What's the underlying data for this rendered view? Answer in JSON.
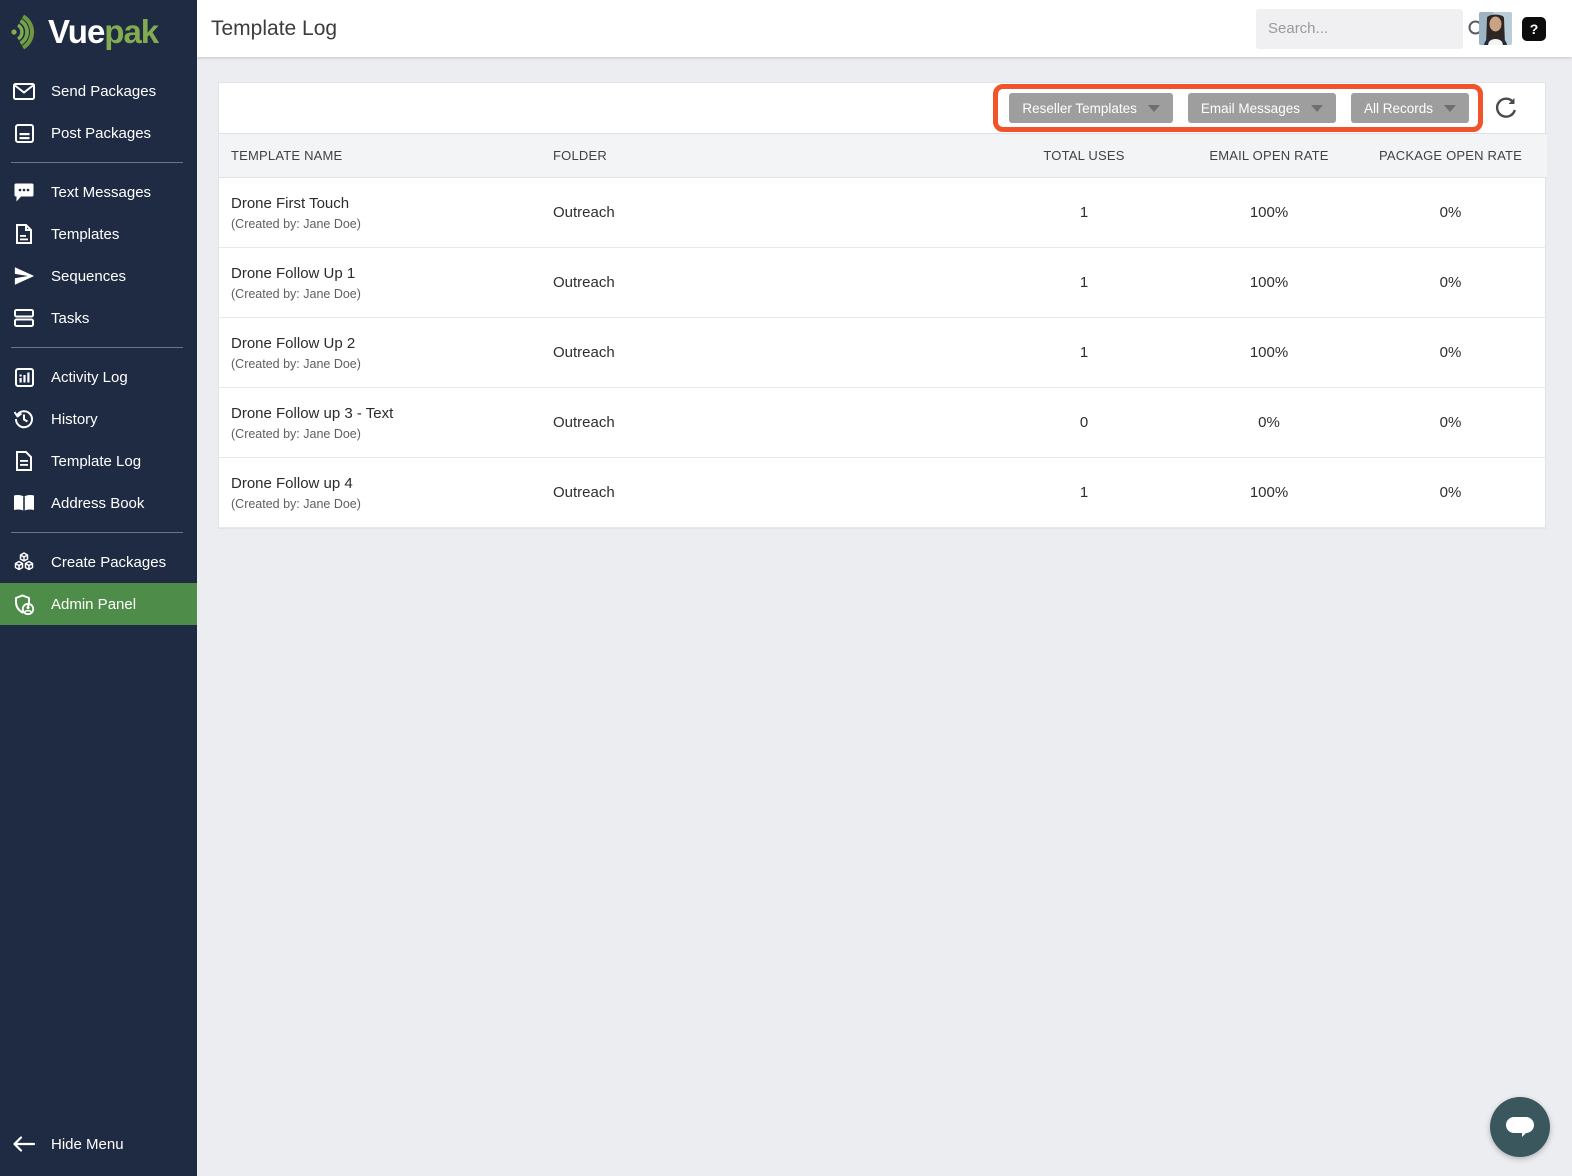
{
  "brand": {
    "logo_icon": "sound-wave-arcs-icon",
    "name_primary": "Vue",
    "name_secondary": "pak"
  },
  "header": {
    "title": "Template Log",
    "search_placeholder": "Search...",
    "help_label": "?",
    "icons": [
      "search-icon",
      "user-avatar",
      "help-icon"
    ]
  },
  "sidebar": {
    "sections": [
      {
        "items": [
          {
            "icon": "envelope-icon",
            "label": "Send Packages"
          },
          {
            "icon": "post-document-icon",
            "label": "Post Packages"
          }
        ]
      },
      {
        "items": [
          {
            "icon": "chat-bubble-dots-icon",
            "label": "Text Messages"
          },
          {
            "icon": "file-icon",
            "label": "Templates"
          },
          {
            "icon": "send-plane-icon",
            "label": "Sequences"
          },
          {
            "icon": "stacked-rows-icon",
            "label": "Tasks"
          }
        ]
      },
      {
        "items": [
          {
            "icon": "bar-chart-icon",
            "label": "Activity Log"
          },
          {
            "icon": "history-clock-icon",
            "label": "History"
          },
          {
            "icon": "file-lines-icon",
            "label": "Template Log"
          },
          {
            "icon": "address-book-icon",
            "label": "Address Book"
          }
        ]
      },
      {
        "items": [
          {
            "icon": "cubes-icon",
            "label": "Create Packages"
          },
          {
            "icon": "admin-shield-icon",
            "label": "Admin Panel",
            "active": true
          }
        ]
      }
    ],
    "footer": {
      "icon": "back-arrow-icon",
      "label": "Hide Menu"
    }
  },
  "toolbar": {
    "dropdowns": [
      {
        "label": "Reseller Templates",
        "icon": "caret-down-icon"
      },
      {
        "label": "Email Messages",
        "icon": "caret-down-icon"
      },
      {
        "label": "All Records",
        "icon": "caret-down-icon"
      }
    ],
    "refresh_icon": "refresh-icon",
    "annotation": "orange-highlight-box"
  },
  "table": {
    "columns": [
      "TEMPLATE NAME",
      "FOLDER",
      "TOTAL USES",
      "EMAIL OPEN RATE",
      "PACKAGE OPEN RATE"
    ],
    "rows": [
      {
        "name": "Drone First Touch",
        "created_by": "(Created by: Jane Doe)",
        "folder": "Outreach",
        "total_uses": "1",
        "email_open_rate": "100%",
        "package_open_rate": "0%"
      },
      {
        "name": "Drone Follow Up 1",
        "created_by": "(Created by: Jane Doe)",
        "folder": "Outreach",
        "total_uses": "1",
        "email_open_rate": "100%",
        "package_open_rate": "0%"
      },
      {
        "name": "Drone Follow Up 2",
        "created_by": "(Created by: Jane Doe)",
        "folder": "Outreach",
        "total_uses": "1",
        "email_open_rate": "100%",
        "package_open_rate": "0%"
      },
      {
        "name": "Drone Follow up 3 - Text",
        "created_by": "(Created by: Jane Doe)",
        "folder": "Outreach",
        "total_uses": "0",
        "email_open_rate": "0%",
        "package_open_rate": "0%"
      },
      {
        "name": "Drone Follow up 4",
        "created_by": "(Created by: Jane Doe)",
        "folder": "Outreach",
        "total_uses": "1",
        "email_open_rate": "100%",
        "package_open_rate": "0%"
      }
    ]
  },
  "chat": {
    "icon": "chat-launcher-icon"
  },
  "colors": {
    "sidebar_navy": "#1f2b42",
    "active_green": "#4e8c49",
    "logo_green": "#82ab52",
    "annotation_orange": "#f1542b",
    "button_gray": "#9e9e9e",
    "chat_teal": "#3a575d",
    "content_bg": "#ecedf1"
  }
}
